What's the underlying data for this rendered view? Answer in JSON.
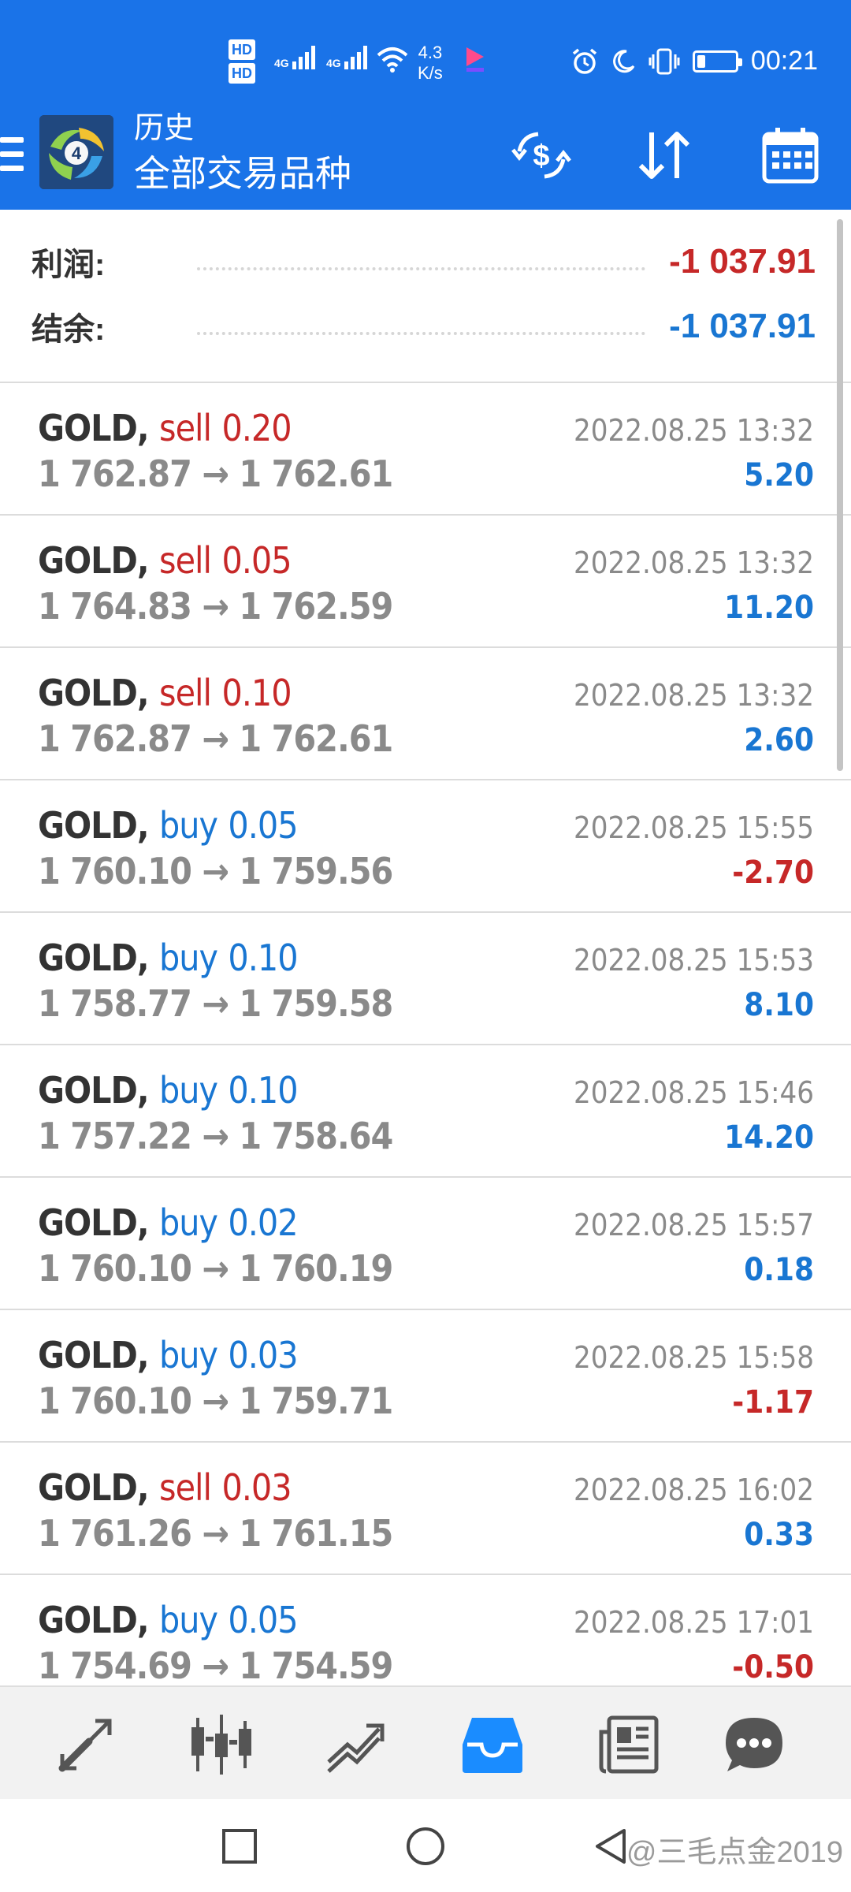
{
  "status_bar": {
    "hd1": "HD",
    "hd2": "HD",
    "net1": "4G",
    "net2": "4G",
    "speed_value": "4.3",
    "speed_unit": "K/s",
    "time": "00:21",
    "battery_level_percent": 20
  },
  "app_bar": {
    "title": "历史",
    "subtitle": "全部交易品种",
    "brand_color": "#1a73e8"
  },
  "summary": {
    "profit_label": "利润:",
    "profit_value": "-1 037.91",
    "balance_label": "结余:",
    "balance_value": "-1 037.91"
  },
  "colors": {
    "sell": "#c62828",
    "buy": "#1976d2",
    "positive": "#1976d2",
    "negative": "#c62828"
  },
  "trades": [
    {
      "symbol": "GOLD,",
      "side": "sell",
      "lot": "0.20",
      "open": "1 762.87",
      "arrow": "→",
      "close": "1 762.61",
      "time": "2022.08.25 13:32",
      "profit": "5.20"
    },
    {
      "symbol": "GOLD,",
      "side": "sell",
      "lot": "0.05",
      "open": "1 764.83",
      "arrow": "→",
      "close": "1 762.59",
      "time": "2022.08.25 13:32",
      "profit": "11.20"
    },
    {
      "symbol": "GOLD,",
      "side": "sell",
      "lot": "0.10",
      "open": "1 762.87",
      "arrow": "→",
      "close": "1 762.61",
      "time": "2022.08.25 13:32",
      "profit": "2.60"
    },
    {
      "symbol": "GOLD,",
      "side": "buy",
      "lot": "0.05",
      "open": "1 760.10",
      "arrow": "→",
      "close": "1 759.56",
      "time": "2022.08.25 15:55",
      "profit": "-2.70"
    },
    {
      "symbol": "GOLD,",
      "side": "buy",
      "lot": "0.10",
      "open": "1 758.77",
      "arrow": "→",
      "close": "1 759.58",
      "time": "2022.08.25 15:53",
      "profit": "8.10"
    },
    {
      "symbol": "GOLD,",
      "side": "buy",
      "lot": "0.10",
      "open": "1 757.22",
      "arrow": "→",
      "close": "1 758.64",
      "time": "2022.08.25 15:46",
      "profit": "14.20"
    },
    {
      "symbol": "GOLD,",
      "side": "buy",
      "lot": "0.02",
      "open": "1 760.10",
      "arrow": "→",
      "close": "1 760.19",
      "time": "2022.08.25 15:57",
      "profit": "0.18"
    },
    {
      "symbol": "GOLD,",
      "side": "buy",
      "lot": "0.03",
      "open": "1 760.10",
      "arrow": "→",
      "close": "1 759.71",
      "time": "2022.08.25 15:58",
      "profit": "-1.17"
    },
    {
      "symbol": "GOLD,",
      "side": "sell",
      "lot": "0.03",
      "open": "1 761.26",
      "arrow": "→",
      "close": "1 761.15",
      "time": "2022.08.25 16:02",
      "profit": "0.33"
    },
    {
      "symbol": "GOLD,",
      "side": "buy",
      "lot": "0.05",
      "open": "1 754.69",
      "arrow": "→",
      "close": "1 754.59",
      "time": "2022.08.25 17:01",
      "profit": "-0.50"
    }
  ],
  "bottom_nav": {
    "items": [
      "quotes-icon",
      "chart-icon",
      "trade-icon",
      "history-icon",
      "news-icon",
      "chat-icon"
    ],
    "active": "history-icon",
    "active_color": "#1a8cff"
  },
  "watermark": "@三毛点金2019"
}
